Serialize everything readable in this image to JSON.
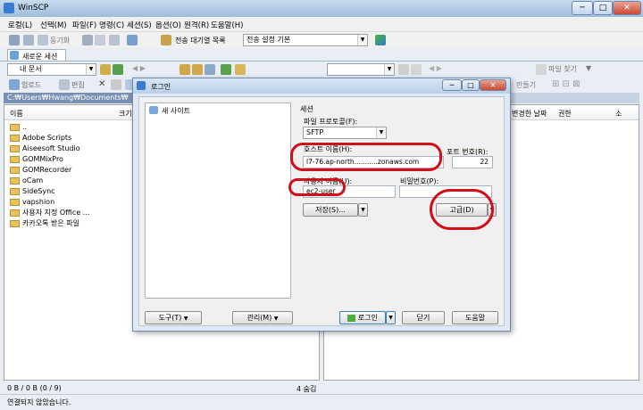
{
  "window": {
    "title": "WinSCP",
    "minimize": "─",
    "maximize": "□",
    "close": "✕"
  },
  "menu": [
    "로컬(L)",
    "선택(M)",
    "파일(F)",
    "명령(C)",
    "세션(S)",
    "옵션(O)",
    "원격(R)",
    "도움말(H)"
  ],
  "toolbar1": {
    "sync_label": "동기화",
    "queue_label": "전송 대기열 목록",
    "transfer_settings": "전송 설정 기본"
  },
  "tab": {
    "label": "새로운 세션"
  },
  "local": {
    "path_combo": "내 문서",
    "toolbar": {
      "upload": "업로드",
      "edit": "편집"
    },
    "path": "C:₩Users₩Hwang₩Documents₩",
    "columns": [
      "이름",
      "크기"
    ],
    "files": [
      "..",
      "Adobe Scripts",
      "Aiseesoft Studio",
      "GOMMixPro",
      "GOMRecorder",
      "oCam",
      "SideSync",
      "vapshion",
      "사용자 지정 Office ...",
      "카카오톡 받은 파일"
    ],
    "status_size": "0 B / 0 B (0 / 9)",
    "status_hidden": "4 숨김"
  },
  "remote": {
    "find_files": "파일 찾기",
    "create": "만들기",
    "columns": [
      "변경한 날짜",
      "권한",
      "소"
    ]
  },
  "statusbar": {
    "text": "연결되지 않았습니다."
  },
  "dialog": {
    "title": "로그인",
    "site_tree": [
      "새 사이트"
    ],
    "session_label": "세션",
    "protocol_label": "파일 프로토콜(F):",
    "protocol_value": "SFTP",
    "host_label": "호스트 이름(H):",
    "host_value": "l7-76.ap-north...........zonaws.com",
    "port_label": "포트 번호(R):",
    "port_value": "22",
    "user_label": "사용자 이름(U):",
    "user_value": "ec2-user",
    "password_label": "비밀번호(P):",
    "password_value": "",
    "save_button": "저장(S)...",
    "advanced_button": "고급(D)",
    "tools_button": "도구(T)",
    "manage_button": "관리(M)",
    "login_button": "로그인",
    "close_button": "닫기",
    "help_button": "도움말"
  },
  "colors": {
    "highlight": "#d10f1a",
    "title_gradient": "#9fbcdb",
    "folder": "#e9c25b"
  }
}
